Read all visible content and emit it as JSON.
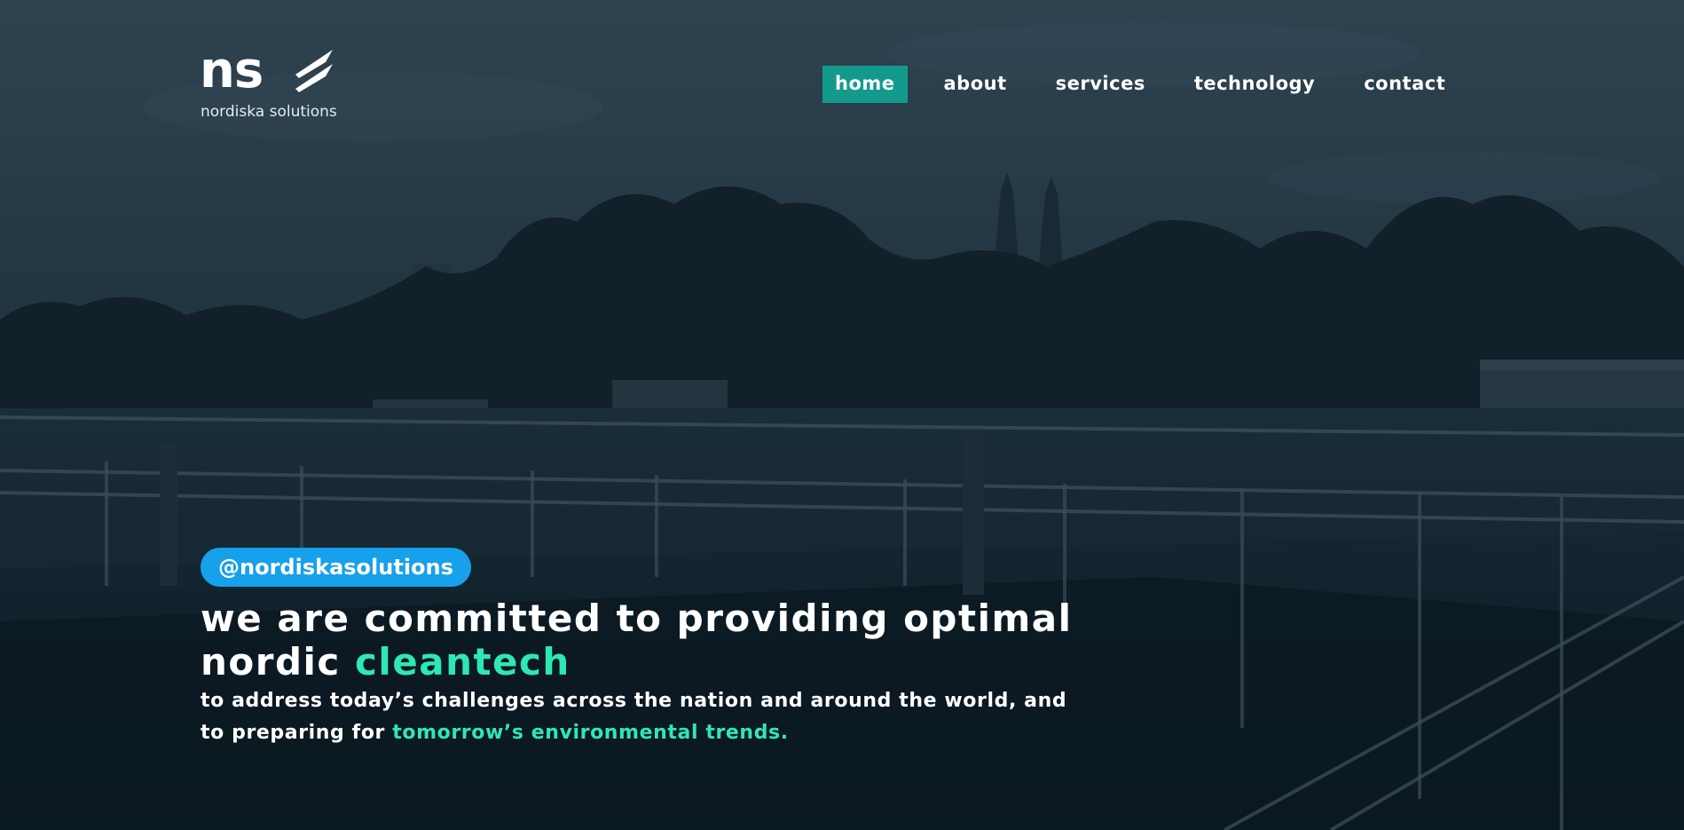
{
  "logo": {
    "mark": "ns",
    "name": "nordiska solutions"
  },
  "nav": {
    "items": [
      {
        "label": "home",
        "active": true
      },
      {
        "label": "about",
        "active": false
      },
      {
        "label": "services",
        "active": false
      },
      {
        "label": "technology",
        "active": false
      },
      {
        "label": "contact",
        "active": false
      }
    ]
  },
  "hero": {
    "handle": "@nordiskasolutions",
    "headline_main": "we are committed to providing optimal nordic ",
    "headline_accent": "cleantech",
    "subline_main": "to address today’s challenges across the nation and around the world, and to preparing for ",
    "subline_accent": "tomorrow’s environmental trends.",
    "background_image": "water-treatment-plant-photo"
  },
  "colors": {
    "active_nav_bg": "#149a8c",
    "accent_text": "#2ee8b4",
    "badge_bg": "#17a0ec",
    "overlay": "#0c1a24"
  }
}
